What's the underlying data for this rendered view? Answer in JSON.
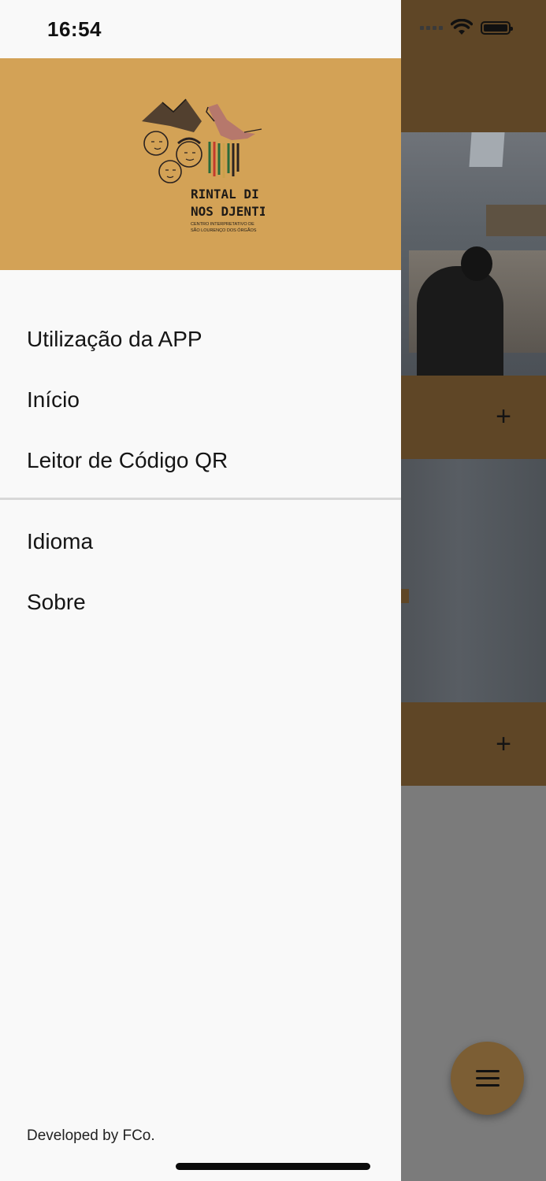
{
  "status_bar": {
    "time": "16:54"
  },
  "drawer": {
    "logo": {
      "name": "rintal-di-nos-djentis-logo",
      "title_line1": "RINTAL DI",
      "title_line2": "NOS DJENTIS",
      "subtitle_line1": "CENTRO INTERPRETATIVO DE",
      "subtitle_line2": "SÃO LOURENÇO DOS ÓRGÃOS"
    },
    "menu_primary": [
      {
        "label": "Utilização da APP"
      },
      {
        "label": "Início"
      },
      {
        "label": "Leitor de Código QR"
      }
    ],
    "menu_secondary": [
      {
        "label": "Idioma"
      },
      {
        "label": "Sobre"
      }
    ],
    "footer": "Developed by FCo."
  },
  "background": {
    "card1_expand_icon": "plus-icon",
    "card2_expand_icon": "plus-icon",
    "fab_icon": "menu-icon",
    "card1_expand_symbol": "+",
    "card2_expand_symbol": "+"
  },
  "colors": {
    "drawer_header": "#d3a256",
    "drawer_bg": "#f9f9f9",
    "fab": "#7c5e34"
  }
}
